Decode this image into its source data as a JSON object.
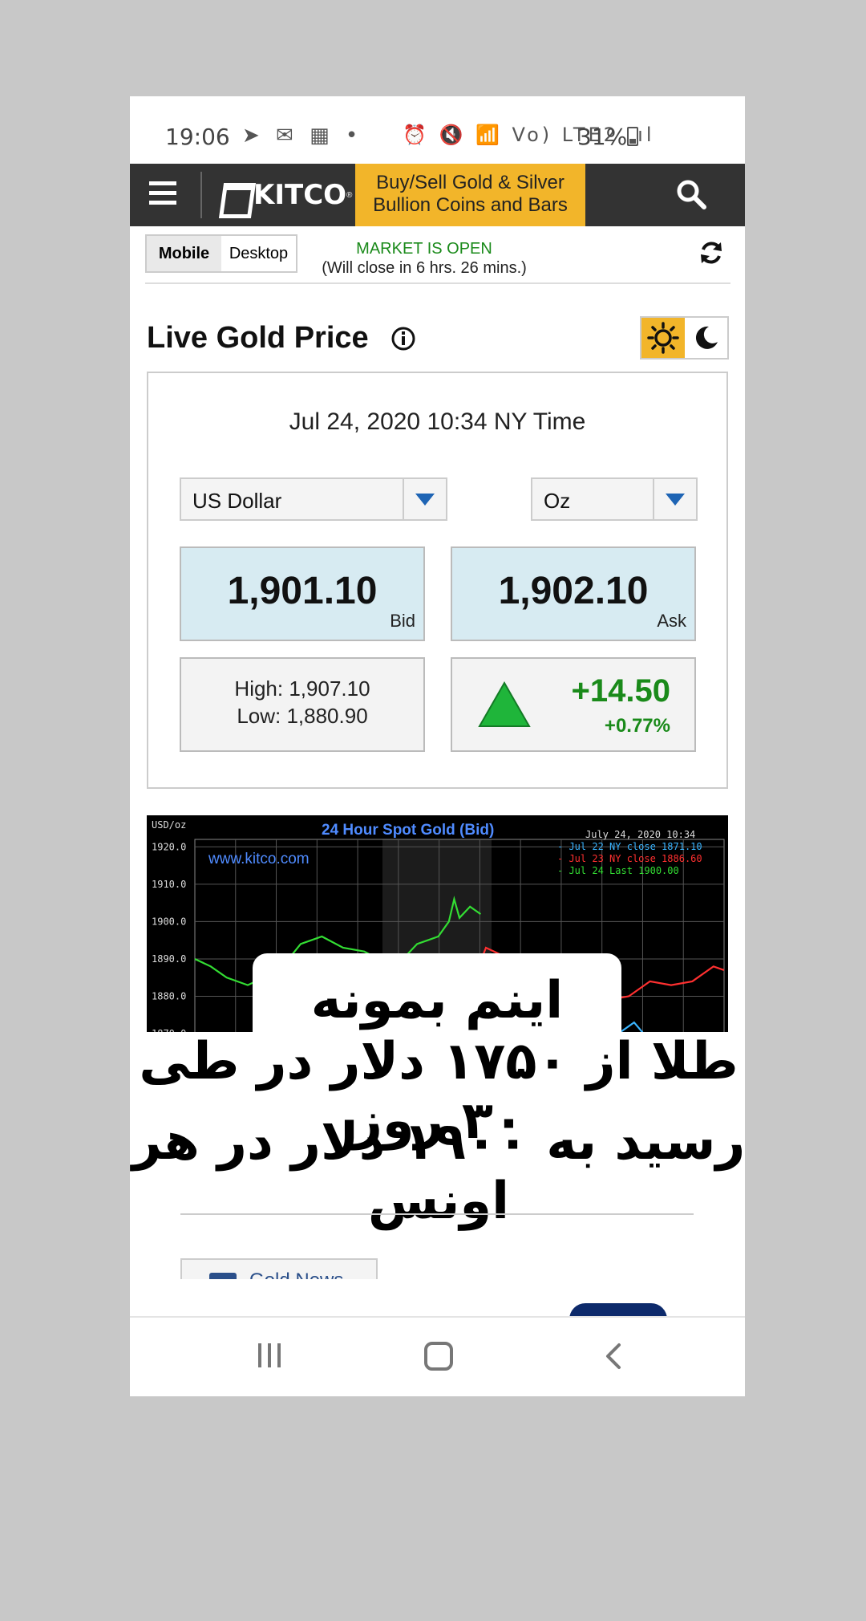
{
  "status_bar": {
    "time": "19:06",
    "left_icons": "➤ ✉ ▦ •",
    "right_icons": "⏰ 🔇 📶 Vo) LTE2 .ıl",
    "battery": "31%"
  },
  "header": {
    "brand": "KITCO",
    "promo_line1": "Buy/Sell Gold & Silver",
    "promo_line2": "Bullion Coins and Bars"
  },
  "market": {
    "toggle": [
      "Mobile",
      "Desktop"
    ],
    "active_toggle": "Mobile",
    "status": "MARKET IS OPEN",
    "close_note": "(Will close in 6 hrs. 26 mins.)"
  },
  "page": {
    "title": "Live Gold Price"
  },
  "quote": {
    "datetime": "Jul 24, 2020 10:34 NY Time",
    "currency": "US Dollar",
    "unit": "Oz",
    "bid": "1,901.10",
    "bid_label": "Bid",
    "ask": "1,902.10",
    "ask_label": "Ask",
    "high": "High: 1,907.10",
    "low": "Low: 1,880.90",
    "change": "+14.50",
    "change_pct": "+0.77%"
  },
  "colors": {
    "accent": "#f2b52a",
    "header_bg": "#333333",
    "up": "#1a8a1a",
    "quote_bg": "#d7ebf2"
  },
  "chart_data": {
    "type": "line",
    "title": "24 Hour Spot Gold (Bid)",
    "ylabel": "USD/oz",
    "watermark": "www.kitco.com",
    "timestamp": "July 24, 2020 10:34",
    "ylim": [
      1864,
      1922
    ],
    "yticks": [
      "1920.0",
      "1910.0",
      "1900.0",
      "1890.0",
      "1880.0",
      "1870.0"
    ],
    "ytick_values": [
      1920,
      1910,
      1900,
      1890,
      1880,
      1870
    ],
    "legend": [
      {
        "text": "- Jul 22 NY close 1871.10",
        "color": "#3ab4ff"
      },
      {
        "text": "- Jul 23 NY close 1886.60",
        "color": "#ff3030"
      },
      {
        "text": "- Jul 24 Last 1900.00",
        "color": "#33dd33"
      }
    ],
    "series": [
      {
        "name": "Jul 22",
        "color": "#3ab4ff",
        "x": [
          0.8,
          0.83,
          0.86,
          0.89,
          0.92,
          0.95,
          0.98,
          1.0
        ],
        "values": [
          1870,
          1873,
          1868,
          1869,
          1866,
          1867,
          1866,
          1867
        ]
      },
      {
        "name": "Jul 23",
        "color": "#ff3030",
        "x": [
          0.0,
          0.05,
          0.1,
          0.12,
          0.2,
          0.3,
          0.4,
          0.5,
          0.52,
          0.55,
          0.58,
          0.62,
          0.66,
          0.7,
          0.74,
          0.78,
          0.82,
          0.86,
          0.9,
          0.94,
          0.98,
          1.0
        ],
        "values": [
          1868,
          1870,
          1869,
          1871,
          1872,
          1870,
          1873,
          1874,
          1882,
          1893,
          1891,
          1891,
          1888,
          1884,
          1881,
          1879,
          1880,
          1884,
          1883,
          1884,
          1888,
          1887
        ]
      },
      {
        "name": "Jul 24",
        "color": "#33dd33",
        "x": [
          0.0,
          0.03,
          0.06,
          0.1,
          0.13,
          0.16,
          0.2,
          0.24,
          0.28,
          0.32,
          0.36,
          0.4,
          0.42,
          0.44,
          0.46,
          0.48,
          0.49,
          0.5,
          0.52,
          0.54
        ],
        "values": [
          1890,
          1888,
          1885,
          1883,
          1885,
          1887,
          1894,
          1896,
          1893,
          1892,
          1889,
          1891,
          1894,
          1895,
          1896,
          1900,
          1906,
          1901,
          1904,
          1902
        ]
      }
    ]
  },
  "caption": {
    "line1": "اینم بمونه اینجا",
    "line2": "طلا از ۱۷۵۰ دلار در طی ۳۰ روز",
    "line3": "رسید به ۱۹۰۰ دلار در هر اونس"
  },
  "below": {
    "news_button": "Gold News"
  }
}
